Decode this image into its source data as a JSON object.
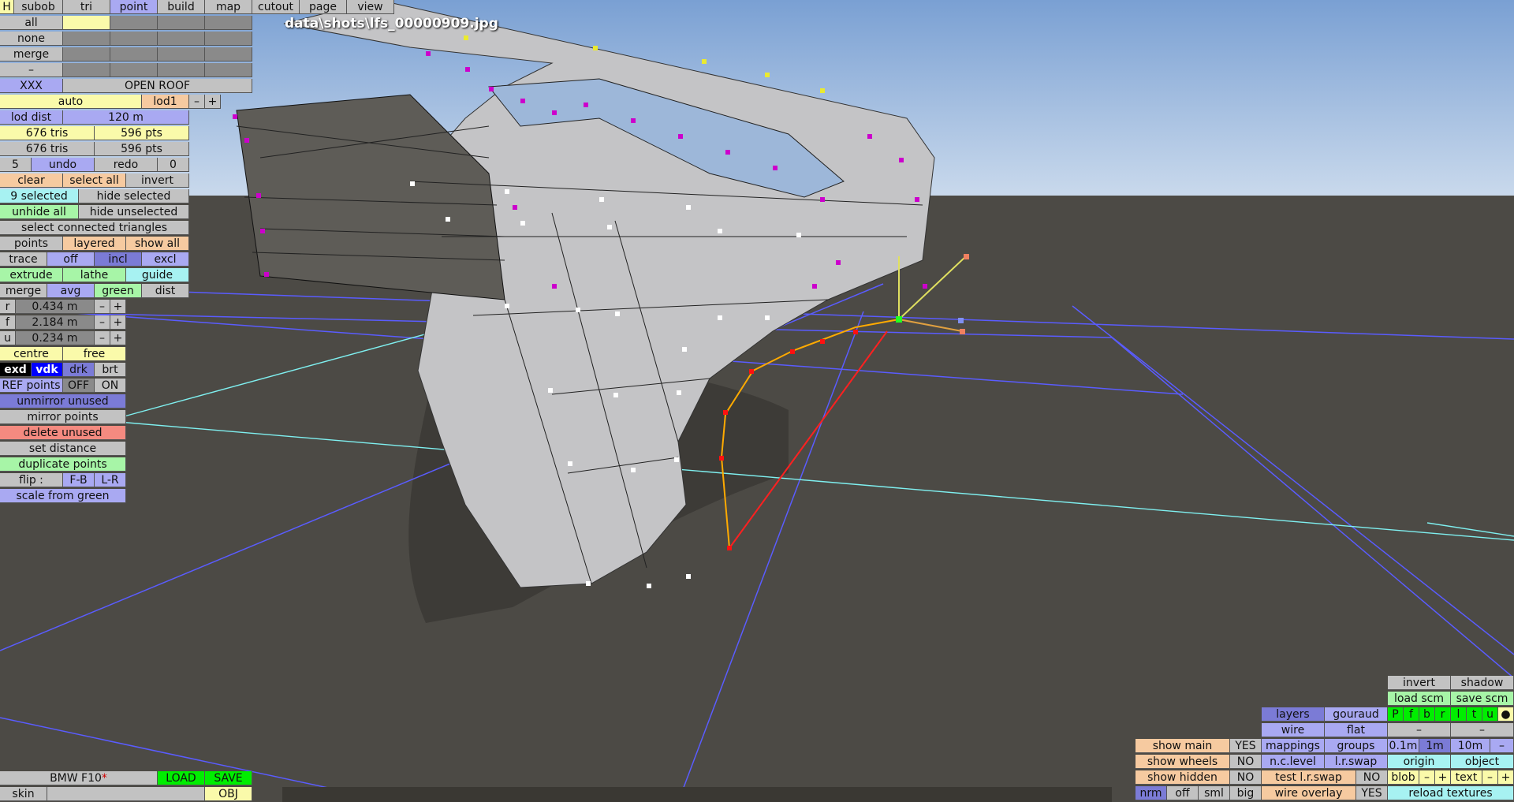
{
  "file_label": "data\\shots\\lfs_00000909.jpg",
  "top_tabs": [
    "H",
    "subob",
    "tri",
    "point",
    "build",
    "map",
    "cutout",
    "page",
    "view"
  ],
  "select": {
    "all": "all",
    "none": "none",
    "merge": "merge",
    "dash": "–"
  },
  "xxx": "XXX",
  "open_roof": "OPEN ROOF",
  "lod": {
    "auto": "auto",
    "lod1": "lod1",
    "minus": "–",
    "plus": "+",
    "dist_label": "lod dist",
    "dist_value": "120 m"
  },
  "counts": {
    "tris1": "676 tris",
    "pts1": "596 pts",
    "tris2": "676 tris",
    "pts2": "596 pts"
  },
  "undo_row": {
    "left": "5",
    "undo": "undo",
    "redo": "redo",
    "right": "0"
  },
  "sel_row": {
    "clear": "clear",
    "select_all": "select all",
    "invert": "invert"
  },
  "sel_row2": {
    "selected": "9 selected",
    "hide_selected": "hide selected"
  },
  "sel_row3": {
    "unhide_all": "unhide all",
    "hide_unselected": "hide unselected"
  },
  "select_connected": "select connected triangles",
  "points_row": {
    "points": "points",
    "layered": "layered",
    "show_all": "show all"
  },
  "trace_row": {
    "trace": "trace",
    "off": "off",
    "incl": "incl",
    "excl": "excl"
  },
  "extrude_row": {
    "extrude": "extrude",
    "lathe": "lathe",
    "guide": "guide"
  },
  "merge_row": {
    "merge": "merge",
    "avg": "avg",
    "green": "green",
    "dist": "dist"
  },
  "rfu": [
    {
      "label": "r",
      "value": "0.434 m"
    },
    {
      "label": "f",
      "value": "2.184 m"
    },
    {
      "label": "u",
      "value": "0.234 m"
    }
  ],
  "centre_row": {
    "centre": "centre",
    "free": "free"
  },
  "style_row": {
    "exd": "exd",
    "vdk": "vdk",
    "drk": "drk",
    "brt": "brt"
  },
  "ref_row": {
    "label": "REF points",
    "off": "OFF",
    "on": "ON"
  },
  "actions": {
    "unmirror": "unmirror unused",
    "mirror": "mirror points",
    "delete": "delete unused",
    "set_distance": "set distance",
    "duplicate": "duplicate points",
    "flip": "flip :",
    "fb": "F-B",
    "lr": "L-R",
    "scale": "scale from green"
  },
  "bottom_left": {
    "car": "BMW F10",
    "asterisk": "*",
    "load": "LOAD",
    "save": "SAVE",
    "skin": "skin",
    "obj": "OBJ"
  },
  "br": {
    "invert": "invert",
    "shadow": "shadow",
    "load_scm": "load scm",
    "save_scm": "save scm",
    "layers": "layers",
    "gouraud": "gouraud",
    "layer_letters": [
      "P",
      "f",
      "b",
      "r",
      "l",
      "t",
      "u",
      "●"
    ],
    "wire": "wire",
    "flat": "flat",
    "dash1": "–",
    "dash2": "–",
    "show_main": "show main",
    "show_main_val": "YES",
    "mappings": "mappings",
    "groups": "groups",
    "s01": "0.1m",
    "s1": "1m",
    "s10": "10m",
    "sdash": "–",
    "show_wheels": "show wheels",
    "show_wheels_val": "NO",
    "nclevel": "n.c.level",
    "lrswap": "l.r.swap",
    "origin": "origin",
    "object": "object",
    "show_hidden": "show hidden",
    "show_hidden_val": "NO",
    "test_lrswap": "test l.r.swap",
    "test_lrswap_val": "NO",
    "blob": "blob",
    "bminus": "–",
    "bplus": "+",
    "text": "text",
    "tminus": "–",
    "tplus": "+",
    "nrm": "nrm",
    "off": "off",
    "sml": "sml",
    "big": "big",
    "wire_overlay": "wire overlay",
    "wire_overlay_val": "YES",
    "reload": "reload textures"
  },
  "colors": {
    "sky_top": "#7fa3d4",
    "sky_bottom": "#c8d9ec",
    "ground": "#4c4a45",
    "mesh": "#c4c4c6",
    "vertex_magenta": "#cc00cc",
    "wire_blue": "#5a5cff"
  }
}
